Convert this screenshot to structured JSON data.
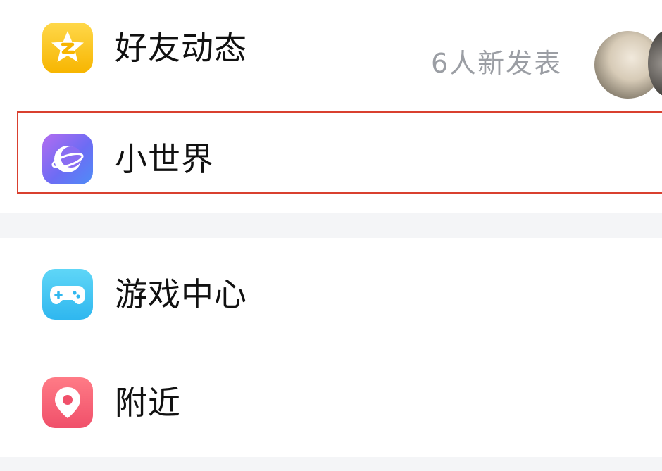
{
  "menu": {
    "friends": {
      "label": "好友动态",
      "status": "6人新发表",
      "icon": "qzone-star-icon"
    },
    "world": {
      "label": "小世界",
      "icon": "crescent-planet-icon",
      "highlighted": true
    },
    "games": {
      "label": "游戏中心",
      "icon": "gamepad-icon"
    },
    "nearby": {
      "label": "附近",
      "icon": "location-pin-icon"
    }
  },
  "colors": {
    "highlight_border": "#d9402f",
    "friends_icon": "#f7b500",
    "world_icon": "#6d6cf4",
    "games_icon": "#2fb7ef",
    "nearby_icon": "#f0506a",
    "status_text": "#9b9ea4"
  }
}
